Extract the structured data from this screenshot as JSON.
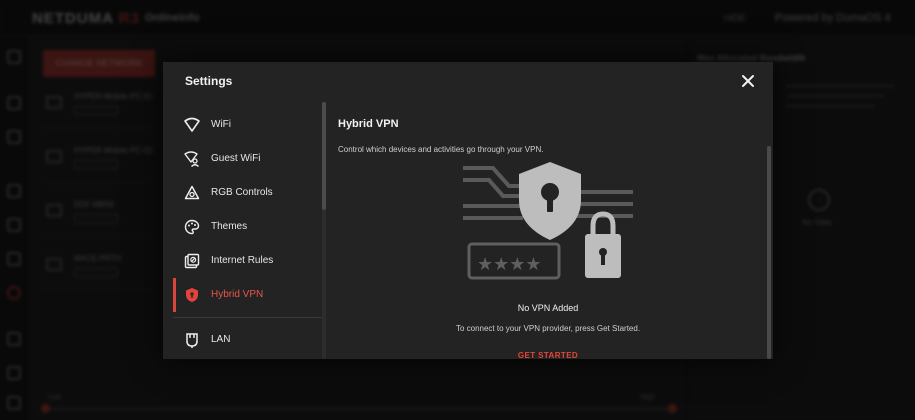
{
  "app": {
    "brand_main": "NETDUMA",
    "brand_suffix": "R3",
    "page_title": "Onlineinfo",
    "top_link": "HIDE",
    "top_right": "Powered by DumaOS 4",
    "action_button": "CHANGE NETWORK",
    "devices": [
      "HYPER-Mobile PC-01",
      "HYPER-Mobile PC-02",
      "DDF-MB56",
      "MACE-PRTH"
    ],
    "right_panel_title": "Max Allocated Bandwidth",
    "no_data": "No Data",
    "slider_min": "Low",
    "slider_max": "High"
  },
  "modal": {
    "title": "Settings",
    "close_icon": "close-icon",
    "menu": [
      {
        "label": "WiFi",
        "icon": "wifi-icon"
      },
      {
        "label": "Guest WiFi",
        "icon": "guest-wifi-icon"
      },
      {
        "label": "RGB Controls",
        "icon": "rgb-icon"
      },
      {
        "label": "Themes",
        "icon": "palette-icon"
      },
      {
        "label": "Internet Rules",
        "icon": "internet-rules-icon"
      },
      {
        "label": "Hybrid VPN",
        "icon": "vpn-shield-icon",
        "active": true
      },
      {
        "label": "LAN",
        "icon": "lan-icon"
      }
    ],
    "content": {
      "title": "Hybrid VPN",
      "description": "Control which devices and activities go through your VPN.",
      "empty_title": "No VPN Added",
      "empty_subtitle": "To connect to your VPN provider, press Get Started.",
      "cta": "GET STARTED"
    }
  },
  "colors": {
    "accent": "#d8463b",
    "modal_bg": "#232323",
    "background": "#141414"
  }
}
